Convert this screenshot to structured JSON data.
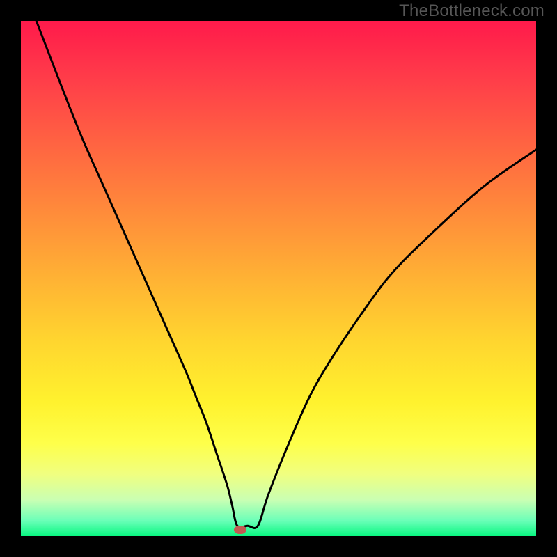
{
  "watermark": "TheBottleneck.com",
  "chart_data": {
    "type": "line",
    "title": "",
    "xlabel": "",
    "ylabel": "",
    "xlim": [
      0,
      100
    ],
    "ylim": [
      0,
      100
    ],
    "grid": false,
    "legend": false,
    "series": [
      {
        "name": "curve",
        "x": [
          3,
          8,
          12,
          16,
          20,
          24,
          28,
          32,
          34,
          36,
          38,
          40,
          41,
          42,
          44,
          46,
          48,
          52,
          56,
          60,
          66,
          72,
          80,
          90,
          100
        ],
        "y": [
          100,
          87,
          77,
          68,
          59,
          50,
          41,
          32,
          27,
          22,
          16,
          10,
          6,
          2,
          2,
          2,
          8,
          18,
          27,
          34,
          43,
          51,
          59,
          68,
          75
        ]
      }
    ],
    "marker": {
      "x": 42.5,
      "y": 1.2,
      "color": "#c25a52"
    },
    "background_gradient": {
      "top": "#ff1a4b",
      "bottom": "#09f781"
    }
  }
}
